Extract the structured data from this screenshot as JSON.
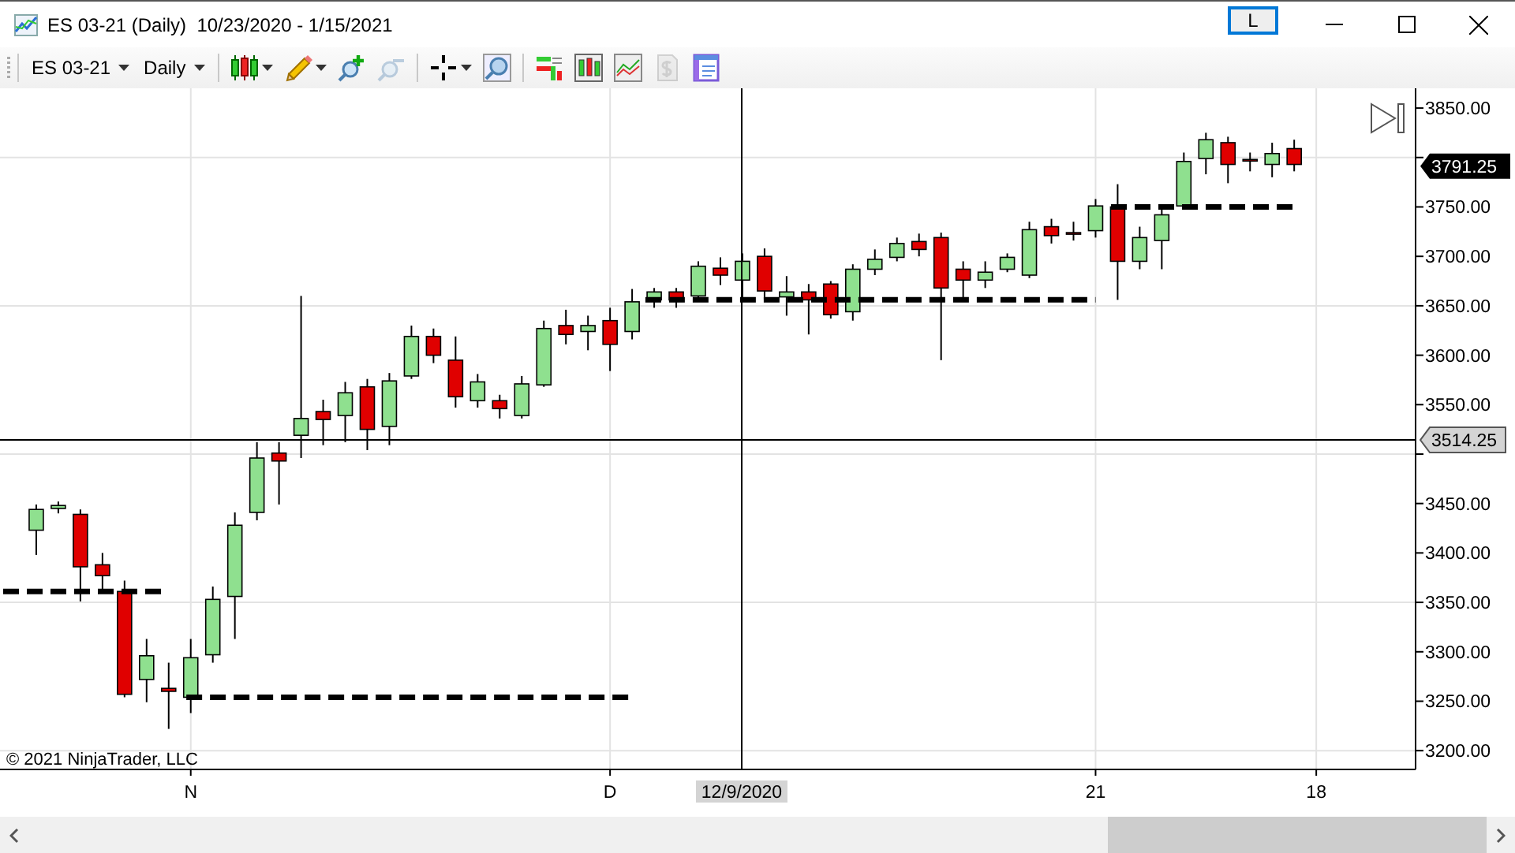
{
  "window": {
    "title": "ES 03-21 (Daily)  10/23/2020 - 1/15/2021",
    "buttons": [
      {
        "label": "L"
      }
    ]
  },
  "toolbar": {
    "groups": [
      {
        "items": [
          {
            "kind": "dropdown",
            "label": "ES 03-21",
            "has_menu": true,
            "disabled": false
          },
          {
            "kind": "dropdown",
            "label": "Daily",
            "has_menu": true,
            "disabled": false
          }
        ]
      },
      {
        "items": [
          {
            "kind": "candles",
            "has_menu": true,
            "disabled": false
          },
          {
            "kind": "pencil",
            "has_menu": true,
            "disabled": false
          },
          {
            "kind": "zoom-in",
            "has_menu": false,
            "disabled": false
          },
          {
            "kind": "zoom-out",
            "has_menu": false,
            "disabled": true
          }
        ]
      },
      {
        "items": [
          {
            "kind": "crosshair",
            "has_menu": true,
            "disabled": false
          },
          {
            "kind": "magnifier",
            "has_menu": false,
            "disabled": false
          }
        ]
      },
      {
        "items": [
          {
            "kind": "data-series",
            "has_menu": false,
            "disabled": false
          },
          {
            "kind": "candle-box",
            "has_menu": false,
            "disabled": false
          },
          {
            "kind": "line-box",
            "has_menu": false,
            "disabled": false
          },
          {
            "kind": "dollar",
            "has_menu": false,
            "disabled": true
          },
          {
            "kind": "panel",
            "has_menu": false,
            "disabled": false
          }
        ]
      }
    ]
  },
  "chart": {
    "copyright": "© 2021 NinjaTrader, LLC",
    "chart_data": {
      "type": "candlestick",
      "grid": true,
      "ylim": [
        3181,
        3870
      ],
      "categories": [
        null,
        null,
        null,
        null,
        null,
        null,
        null,
        "N",
        null,
        null,
        null,
        null,
        null,
        null,
        null,
        null,
        null,
        null,
        null,
        null,
        null,
        null,
        null,
        null,
        null,
        null,
        "D",
        null,
        null,
        null,
        null,
        null,
        null,
        null,
        null,
        null,
        null,
        null,
        null,
        null,
        null,
        null,
        null,
        null,
        null,
        null,
        null,
        null,
        "21",
        null,
        null,
        null,
        null,
        null,
        null,
        null,
        null,
        null,
        "18"
      ],
      "yticks": [
        {
          "value": 3850,
          "label": "3850.00"
        },
        {
          "value": 3750,
          "label": "3750.00"
        },
        {
          "value": 3700,
          "label": "3700.00"
        },
        {
          "value": 3650,
          "label": "3650.00"
        },
        {
          "value": 3600,
          "label": "3600.00"
        },
        {
          "value": 3550,
          "label": "3550.00"
        },
        {
          "value": 3450,
          "label": "3450.00"
        },
        {
          "value": 3400,
          "label": "3400.00"
        },
        {
          "value": 3350,
          "label": "3350.00"
        },
        {
          "value": 3300,
          "label": "3300.00"
        },
        {
          "value": 3250,
          "label": "3250.00"
        },
        {
          "value": 3200,
          "label": "3200.00"
        }
      ],
      "ohlc": [
        [
          3423,
          3449,
          3398,
          3444
        ],
        [
          3445,
          3452,
          3440,
          3448
        ],
        [
          3439,
          3444,
          3351,
          3386
        ],
        [
          3388,
          3400,
          3361,
          3377
        ],
        [
          3361,
          3372,
          3254,
          3257
        ],
        [
          3272,
          3313,
          3249,
          3296
        ],
        [
          3263,
          3289,
          3222,
          3260
        ],
        [
          3254,
          3313,
          3238,
          3294
        ],
        [
          3297,
          3366,
          3289,
          3353
        ],
        [
          3356,
          3441,
          3313,
          3428
        ],
        [
          3441,
          3512,
          3433,
          3496
        ],
        [
          3501,
          3512,
          3449,
          3493
        ],
        [
          3519,
          3660,
          3496,
          3536
        ],
        [
          3543,
          3555,
          3509,
          3535
        ],
        [
          3539,
          3573,
          3512,
          3562
        ],
        [
          3568,
          3576,
          3504,
          3525
        ],
        [
          3528,
          3582,
          3509,
          3574
        ],
        [
          3579,
          3630,
          3576,
          3619
        ],
        [
          3619,
          3627,
          3592,
          3600
        ],
        [
          3595,
          3619,
          3547,
          3558
        ],
        [
          3554,
          3581,
          3547,
          3573
        ],
        [
          3554,
          3560,
          3536,
          3546
        ],
        [
          3539,
          3579,
          3536,
          3571
        ],
        [
          3570,
          3635,
          3568,
          3627
        ],
        [
          3630,
          3646,
          3611,
          3621
        ],
        [
          3624,
          3640,
          3605,
          3630
        ],
        [
          3635,
          3648,
          3584,
          3611
        ],
        [
          3624,
          3667,
          3616,
          3654
        ],
        [
          3656,
          3668,
          3648,
          3664
        ],
        [
          3664,
          3668,
          3648,
          3656
        ],
        [
          3660,
          3695,
          3656,
          3690
        ],
        [
          3688,
          3699,
          3671,
          3681
        ],
        [
          3676,
          3703,
          3656,
          3695
        ],
        [
          3700,
          3708,
          3656,
          3665
        ],
        [
          3659,
          3680,
          3640,
          3664
        ],
        [
          3664,
          3672,
          3621,
          3656
        ],
        [
          3672,
          3675,
          3637,
          3641
        ],
        [
          3644,
          3692,
          3635,
          3687
        ],
        [
          3687,
          3707,
          3681,
          3697
        ],
        [
          3699,
          3719,
          3695,
          3713
        ],
        [
          3715,
          3723,
          3700,
          3707
        ],
        [
          3719,
          3724,
          3595,
          3668
        ],
        [
          3687,
          3695,
          3656,
          3676
        ],
        [
          3676,
          3695,
          3668,
          3684
        ],
        [
          3687,
          3703,
          3684,
          3699
        ],
        [
          3681,
          3735,
          3678,
          3727
        ],
        [
          3730,
          3738,
          3713,
          3721
        ],
        [
          3724,
          3735,
          3716,
          3723
        ],
        [
          3726,
          3758,
          3719,
          3751
        ],
        [
          3750,
          3773,
          3656,
          3695
        ],
        [
          3695,
          3730,
          3687,
          3719
        ],
        [
          3716,
          3751,
          3687,
          3742
        ],
        [
          3751,
          3805,
          3748,
          3796
        ],
        [
          3799,
          3825,
          3783,
          3818
        ],
        [
          3815,
          3821,
          3774,
          3793
        ],
        [
          3798,
          3805,
          3786,
          3797
        ],
        [
          3793,
          3815,
          3780,
          3804
        ],
        [
          3809,
          3818,
          3786,
          3793
        ],
        null
      ]
    },
    "crosshair": {
      "date_label": "12/9/2020",
      "price_label": "3514.25"
    },
    "last_price": {
      "label": "3791.25"
    }
  }
}
